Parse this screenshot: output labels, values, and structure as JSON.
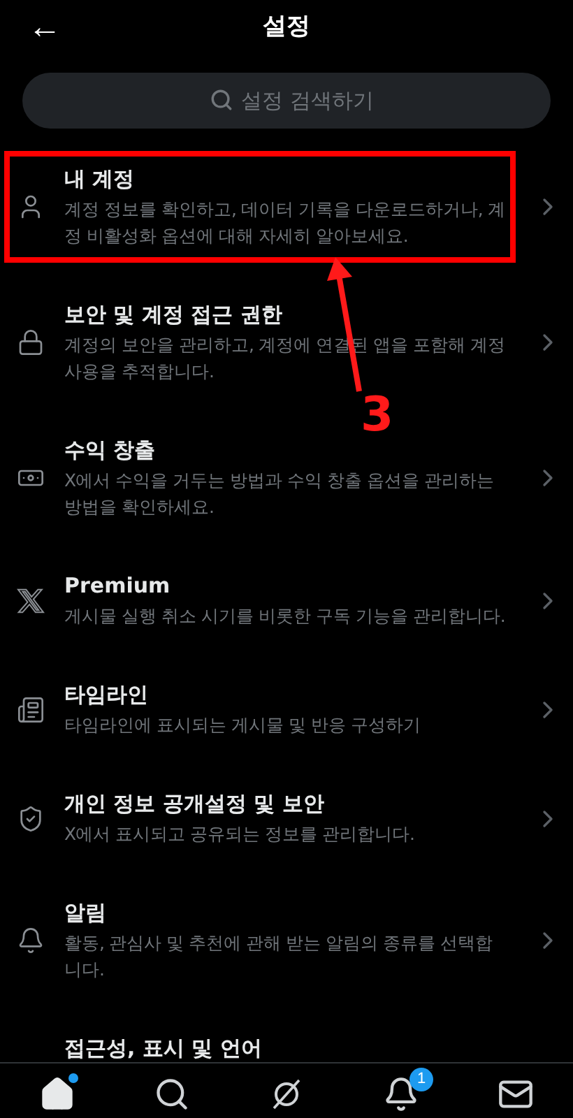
{
  "header": {
    "title": "설정",
    "back": "←"
  },
  "search": {
    "placeholder": "설정 검색하기"
  },
  "items": [
    {
      "kind": "user",
      "title": "내 계정",
      "description": "계정 정보를 확인하고, 데이터 기록을 다운로드하거나, 계정 비활성화 옵션에 대해 자세히 알아보세요.",
      "highlighted": true
    },
    {
      "kind": "lock",
      "title": "보안 및 계정 접근 권한",
      "description": "계정의 보안을 관리하고, 계정에 연결된 앱을 포함해 계정 사용을 추적합니다.",
      "highlighted": false
    },
    {
      "kind": "money",
      "title": "수익 창출",
      "description": "X에서 수익을 거두는 방법과 수익 창출 옵션을 관리하는 방법을 확인하세요.",
      "highlighted": false
    },
    {
      "kind": "x",
      "title": "Premium",
      "description": "게시물 실행 취소 시기를 비롯한 구독 기능을 관리합니다.",
      "highlighted": false
    },
    {
      "kind": "timeline",
      "title": "타임라인",
      "description": "타임라인에 표시되는 게시물 및 반응 구성하기",
      "highlighted": false
    },
    {
      "kind": "shield",
      "title": "개인 정보 공개설정 및 보안",
      "description": "X에서 표시되고 공유되는 정보를 관리합니다.",
      "highlighted": false
    },
    {
      "kind": "bell",
      "title": "알림",
      "description": "활동, 관심사 및 추천에 관해 받는 알림의 종류를 선택합니다.",
      "highlighted": false
    },
    {
      "kind": "cut",
      "title": "접근성, 표시 및 언어",
      "highlighted": false
    }
  ],
  "annotation": {
    "label": "3"
  },
  "nav": [
    {
      "kind": "home",
      "selected": true,
      "dot": true
    },
    {
      "kind": "search",
      "selected": false,
      "dot": false
    },
    {
      "kind": "grok",
      "selected": false,
      "dot": false
    },
    {
      "kind": "bell",
      "selected": false,
      "dot": false,
      "badge": "1"
    },
    {
      "kind": "mail",
      "selected": false,
      "dot": false
    }
  ]
}
